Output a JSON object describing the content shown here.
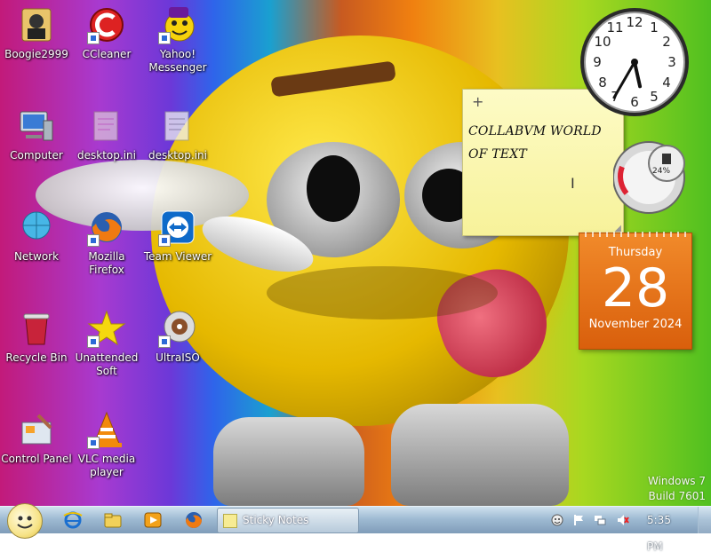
{
  "desktop": {
    "icons": [
      {
        "label": "Boogie2999"
      },
      {
        "label": "CCleaner"
      },
      {
        "label": "Yahoo!\nMessenger"
      },
      {
        "label": "Computer"
      },
      {
        "label": "desktop.ini"
      },
      {
        "label": "desktop.ini"
      },
      {
        "label": "Network"
      },
      {
        "label": "Mozilla Firefox"
      },
      {
        "label": "Team Viewer"
      },
      {
        "label": "Recycle Bin"
      },
      {
        "label": "Unattended\nSoft"
      },
      {
        "label": "UltraISO"
      },
      {
        "label": "Control Panel"
      },
      {
        "label": "VLC media\nplayer"
      }
    ],
    "watermark": {
      "line1": "Windows 7",
      "line2": "Build 7601"
    }
  },
  "sticky_note": {
    "add_symbol": "+",
    "close_symbol": "×",
    "text_line1": "COLLABVM WORLD",
    "text_line2": "OF TEXT"
  },
  "clock_gadget": {
    "hour": 5,
    "minute": 35
  },
  "meter_gadget": {
    "value_label": "24%"
  },
  "calendar_gadget": {
    "weekday": "Thursday",
    "day": "28",
    "month_year": "November 2024"
  },
  "taskbar": {
    "pinned": [
      "internet-explorer-icon",
      "windows-explorer-icon",
      "media-player-icon",
      "firefox-icon"
    ],
    "active_window_label": "Sticky Notes",
    "clock": "5:35 PM"
  },
  "colors": {
    "calendar": "#e66f18",
    "sticky": "#fbf6b0",
    "taskbar": "#9fbbd3"
  }
}
